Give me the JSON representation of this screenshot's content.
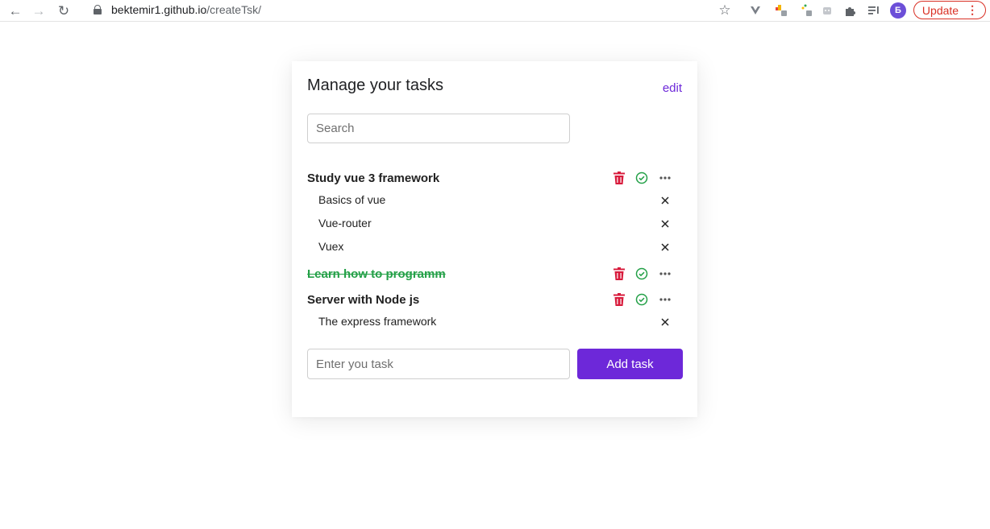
{
  "browser": {
    "url_domain": "bektemir1.github.io",
    "url_path": "/createTsk/",
    "profile_initial": "Б",
    "update_label": "Update"
  },
  "app": {
    "title": "Manage your tasks",
    "edit_label": "edit",
    "search_placeholder": "Search",
    "new_task_placeholder": "Enter you task",
    "add_button_label": "Add task"
  },
  "tasks": [
    {
      "title": "Study vue 3 framework",
      "completed": false,
      "subtasks": [
        "Basics of vue",
        "Vue-router",
        "Vuex"
      ]
    },
    {
      "title": "Learn how to programm",
      "completed": true,
      "subtasks": []
    },
    {
      "title": "Server with Node js",
      "completed": false,
      "subtasks": [
        "The express framework"
      ]
    }
  ],
  "colors": {
    "accent": "#6d28d9",
    "delete": "#d81b3c",
    "done": "#23a047"
  }
}
